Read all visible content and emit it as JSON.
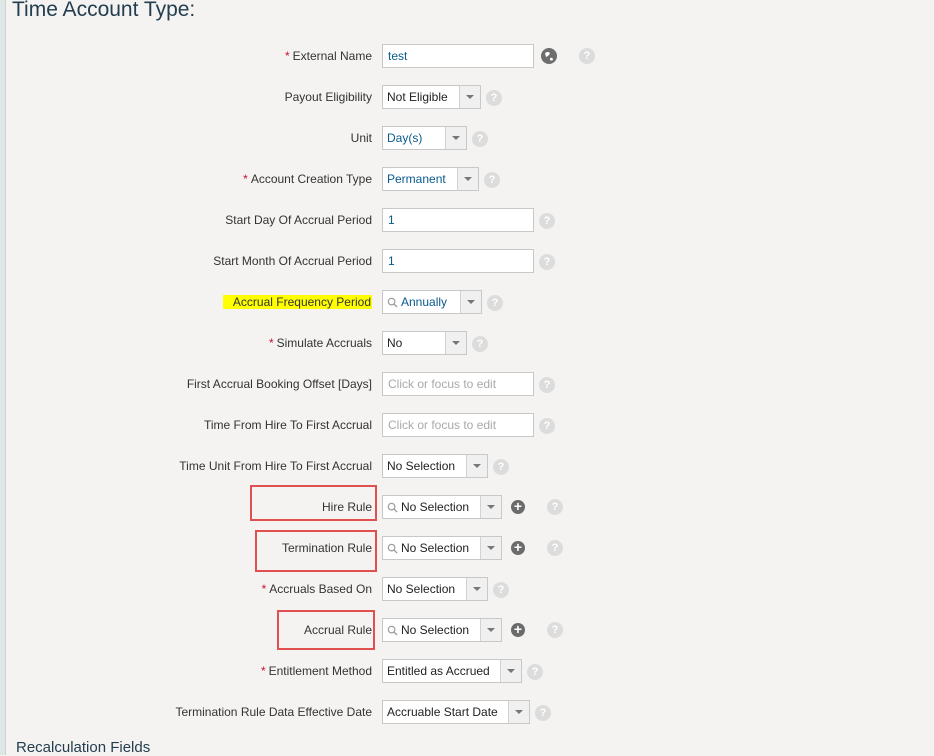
{
  "page_title": "Time Account Type:",
  "section_title": "Recalculation Fields",
  "icons": {
    "help": "?",
    "add": "+"
  },
  "fields": {
    "external_name": {
      "label": "External Name",
      "required": "*",
      "value": "test"
    },
    "payout_eligibility": {
      "label": "Payout Eligibility",
      "value": "Not Eligible"
    },
    "unit": {
      "label": "Unit",
      "value": "Day(s)"
    },
    "account_creation_type": {
      "label": "Account Creation Type",
      "required": "*",
      "value": "Permanent"
    },
    "start_day": {
      "label": "Start Day Of Accrual Period",
      "value": "1"
    },
    "start_month": {
      "label": "Start Month Of Accrual Period",
      "value": "1"
    },
    "accrual_frequency": {
      "label": "Accrual Frequency Period",
      "value": "Annually"
    },
    "simulate_accruals": {
      "label": "Simulate Accruals",
      "required": "*",
      "value": "No"
    },
    "first_booking_offset": {
      "label": "First Accrual Booking Offset [Days]",
      "placeholder": "Click or focus to edit"
    },
    "time_from_hire": {
      "label": "Time From Hire To First Accrual",
      "placeholder": "Click or focus to edit"
    },
    "time_unit_from_hire": {
      "label": "Time Unit From Hire To First Accrual",
      "value": "No Selection"
    },
    "hire_rule": {
      "label": "Hire Rule",
      "value": "No Selection"
    },
    "termination_rule": {
      "label": "Termination Rule",
      "value": "No Selection"
    },
    "accruals_based_on": {
      "label": "Accruals Based On",
      "required": "*",
      "value": "No Selection"
    },
    "accrual_rule": {
      "label": "Accrual Rule",
      "value": "No Selection"
    },
    "entitlement_method": {
      "label": "Entitlement Method",
      "required": "*",
      "value": "Entitled as Accrued"
    },
    "termination_rule_effective_date": {
      "label": "Termination Rule Data Effective Date",
      "value": "Accruable Start Date"
    }
  }
}
